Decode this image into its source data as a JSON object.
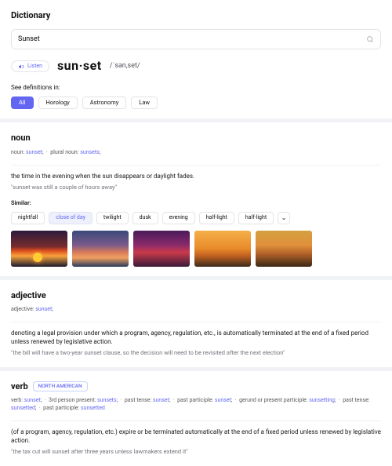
{
  "title": "Dictionary",
  "search": {
    "value": "Sunset"
  },
  "listen_label": "Listen",
  "word_display": "sun·set",
  "pronunciation": "/ˈsən,set/",
  "filters": {
    "label": "See definitions in:",
    "items": [
      "All",
      "Horology",
      "Astronomy",
      "Law"
    ]
  },
  "noun": {
    "pos": "noun",
    "forms_html": "noun: <span class='kw'>sunset</span>; &nbsp;&middot;&nbsp; plural noun: <span class='kw'>sunsets</span>;",
    "definition": "the time in the evening when the sun disappears or daylight fades.",
    "example": "\"sunset was still a couple of hours away\"",
    "similar_label": "Similar:",
    "synonyms": [
      "nightfall",
      "close of day",
      "twilight",
      "dusk",
      "evening",
      "half-light",
      "half-light"
    ]
  },
  "adjective": {
    "pos": "adjective",
    "forms_html": "adjective: <span class='kw'>sunset</span>;",
    "definition": "denoting a legal provision under which a program, agency, regulation, etc., is automatically terminated at the end of a fixed period unless renewed by legislative action.",
    "example": "\"the bill will have a two-year sunset clause, so the decision will need to be revisited after the next election\""
  },
  "verb": {
    "pos": "verb",
    "region": "NORTH AMERICAN",
    "forms_html": "verb: <span class='kw'>sunset</span>; &nbsp;&middot;&nbsp; 3rd person present: <span class='kw'>sunsets</span>; &nbsp;&middot;&nbsp; past tense: <span class='kw'>sunset</span>; &nbsp;&middot;&nbsp; past participle: <span class='kw'>sunset</span>; &nbsp;&middot;&nbsp; gerund or present participle: <span class='kw'>sunsetting</span>; &nbsp;&middot;&nbsp; past tense: <span class='kw'>sunsetted</span>; &nbsp;&middot;&nbsp; past participle: <span class='kw'>sunsetted</span>",
    "definition": "(of a program, agency, regulation, etc.) expire or be terminated automatically at the end of a fixed period unless renewed by legislative action.",
    "example": "\"the tax cut will sunset after three years unless lawmakers extend it\""
  }
}
